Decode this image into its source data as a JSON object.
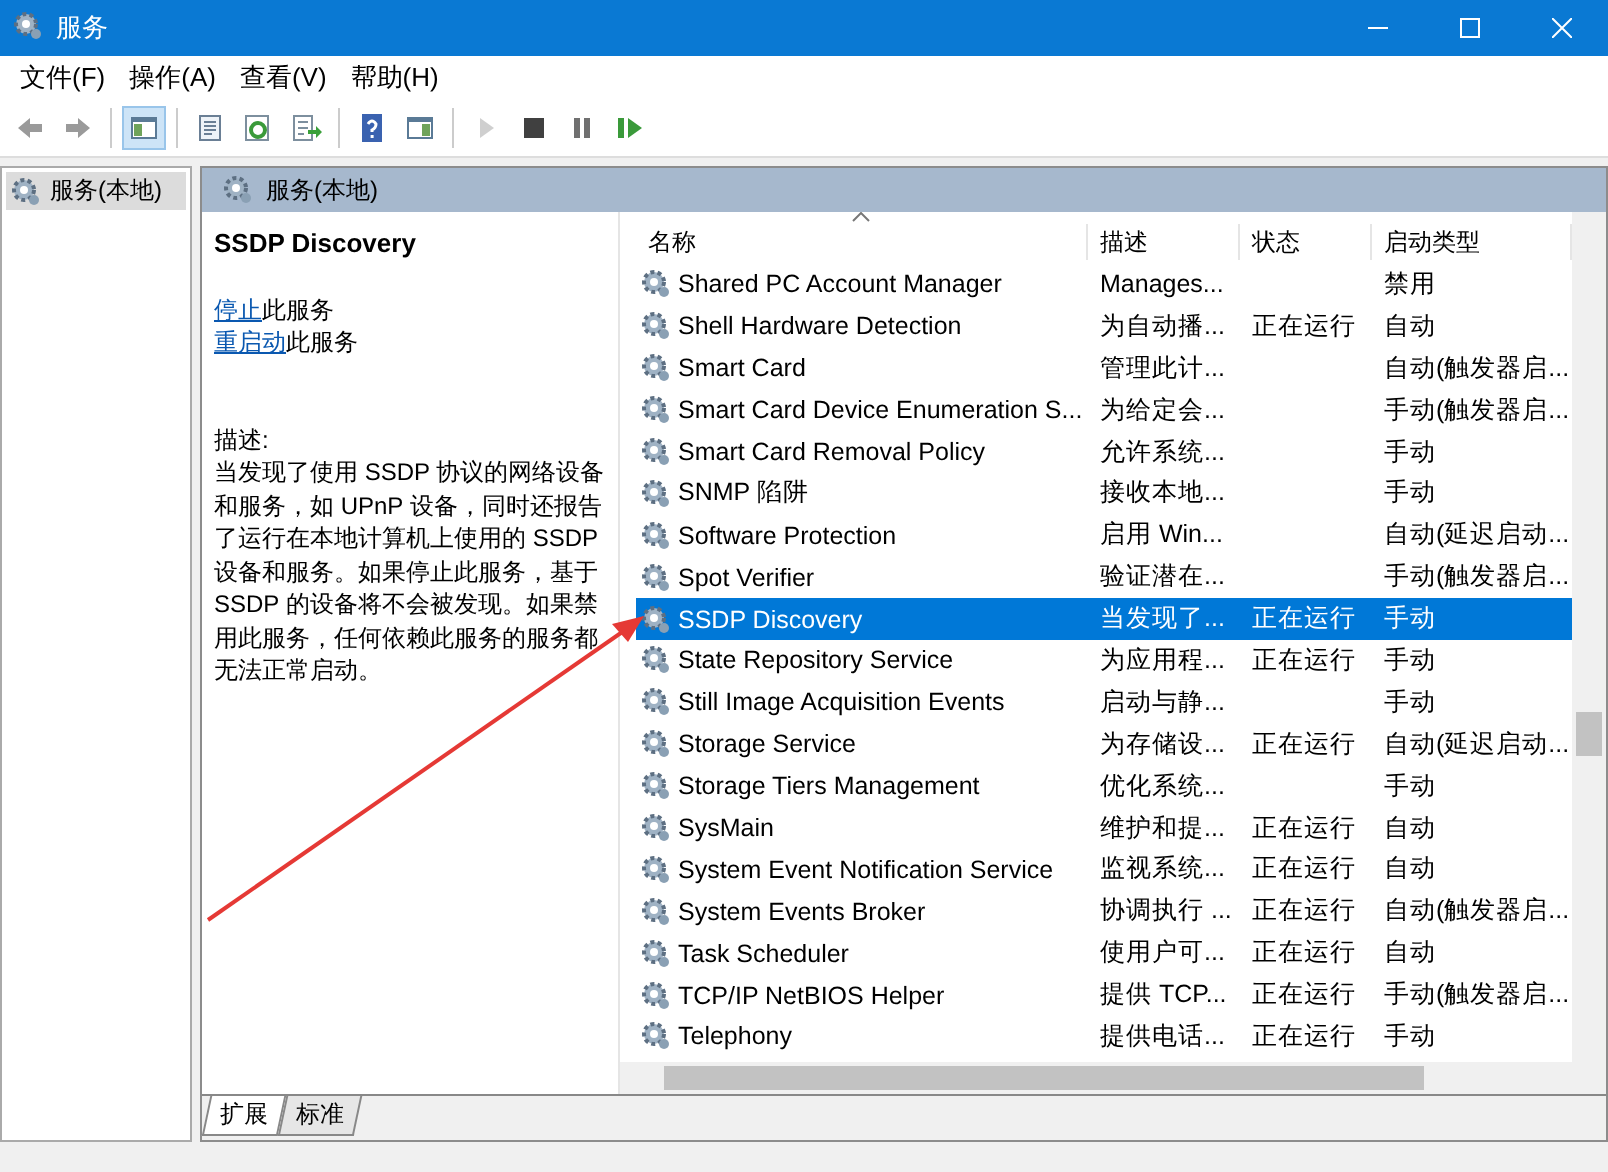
{
  "window": {
    "title": "服务"
  },
  "menu": [
    "文件(F)",
    "操作(A)",
    "查看(V)",
    "帮助(H)"
  ],
  "toolbar": [
    {
      "kind": "back"
    },
    {
      "kind": "forward"
    },
    {
      "kind": "separator"
    },
    {
      "kind": "console-tree",
      "selected": true
    },
    {
      "kind": "separator"
    },
    {
      "kind": "properties",
      "selected": false
    },
    {
      "kind": "refresh",
      "selected": false
    },
    {
      "kind": "export",
      "selected": false
    },
    {
      "kind": "separator"
    },
    {
      "kind": "help",
      "selected": false
    },
    {
      "kind": "action-pane",
      "selected": false
    },
    {
      "kind": "separator"
    },
    {
      "kind": "start",
      "disabled": true
    },
    {
      "kind": "stop",
      "disabled": false
    },
    {
      "kind": "pause",
      "disabled": false
    },
    {
      "kind": "resume",
      "disabled": false
    }
  ],
  "tree": {
    "items": [
      {
        "label": "服务(本地)",
        "selected": true
      }
    ]
  },
  "pane_header": {
    "title": "服务(本地)"
  },
  "details": {
    "service_name": "SSDP Discovery",
    "actions": [
      {
        "link": "停止",
        "text": "此服务"
      },
      {
        "link": "重启动",
        "text": "此服务"
      }
    ],
    "description_label": "描述:",
    "description": "当发现了使用 SSDP 协议的网络设备和服务，如 UPnP 设备，同时还报告了运行在本地计算机上使用的 SSDP 设备和服务。如果停止此服务，基于 SSDP 的设备将不会被发现。如果禁用此服务，任何依赖此服务的服务都无法正常启动。"
  },
  "table": {
    "columns": [
      "名称",
      "描述",
      "状态",
      "启动类型"
    ],
    "rows": [
      {
        "name": "Shared PC Account Manager",
        "description": "Manages...",
        "status": "",
        "startup": "禁用",
        "selected": false
      },
      {
        "name": "Shell Hardware Detection",
        "description": "为自动播...",
        "status": "正在运行",
        "startup": "自动",
        "selected": false
      },
      {
        "name": "Smart Card",
        "description": "管理此计...",
        "status": "",
        "startup": "自动(触发器启...",
        "selected": false
      },
      {
        "name": "Smart Card Device Enumeration S...",
        "description": "为给定会...",
        "status": "",
        "startup": "手动(触发器启...",
        "selected": false
      },
      {
        "name": "Smart Card Removal Policy",
        "description": "允许系统...",
        "status": "",
        "startup": "手动",
        "selected": false
      },
      {
        "name": "SNMP 陷阱",
        "description": "接收本地...",
        "status": "",
        "startup": "手动",
        "selected": false
      },
      {
        "name": "Software Protection",
        "description": "启用 Win...",
        "status": "",
        "startup": "自动(延迟启动...",
        "selected": false
      },
      {
        "name": "Spot Verifier",
        "description": "验证潜在...",
        "status": "",
        "startup": "手动(触发器启...",
        "selected": false
      },
      {
        "name": "SSDP Discovery",
        "description": "当发现了...",
        "status": "正在运行",
        "startup": "手动",
        "selected": true
      },
      {
        "name": "State Repository Service",
        "description": "为应用程...",
        "status": "正在运行",
        "startup": "手动",
        "selected": false
      },
      {
        "name": "Still Image Acquisition Events",
        "description": "启动与静...",
        "status": "",
        "startup": "手动",
        "selected": false
      },
      {
        "name": "Storage Service",
        "description": "为存储设...",
        "status": "正在运行",
        "startup": "自动(延迟启动...",
        "selected": false
      },
      {
        "name": "Storage Tiers Management",
        "description": "优化系统...",
        "status": "",
        "startup": "手动",
        "selected": false
      },
      {
        "name": "SysMain",
        "description": "维护和提...",
        "status": "正在运行",
        "startup": "自动",
        "selected": false
      },
      {
        "name": "System Event Notification Service",
        "description": "监视系统...",
        "status": "正在运行",
        "startup": "自动",
        "selected": false
      },
      {
        "name": "System Events Broker",
        "description": "协调执行 ...",
        "status": "正在运行",
        "startup": "自动(触发器启...",
        "selected": false
      },
      {
        "name": "Task Scheduler",
        "description": "使用户可...",
        "status": "正在运行",
        "startup": "自动",
        "selected": false
      },
      {
        "name": "TCP/IP NetBIOS Helper",
        "description": "提供 TCP...",
        "status": "正在运行",
        "startup": "手动(触发器启...",
        "selected": false
      },
      {
        "name": "Telephony",
        "description": "提供电话...",
        "status": "正在运行",
        "startup": "手动",
        "selected": false
      }
    ]
  },
  "view_tabs": [
    {
      "label": "扩展",
      "selected": true
    },
    {
      "label": "标准",
      "selected": false
    }
  ]
}
